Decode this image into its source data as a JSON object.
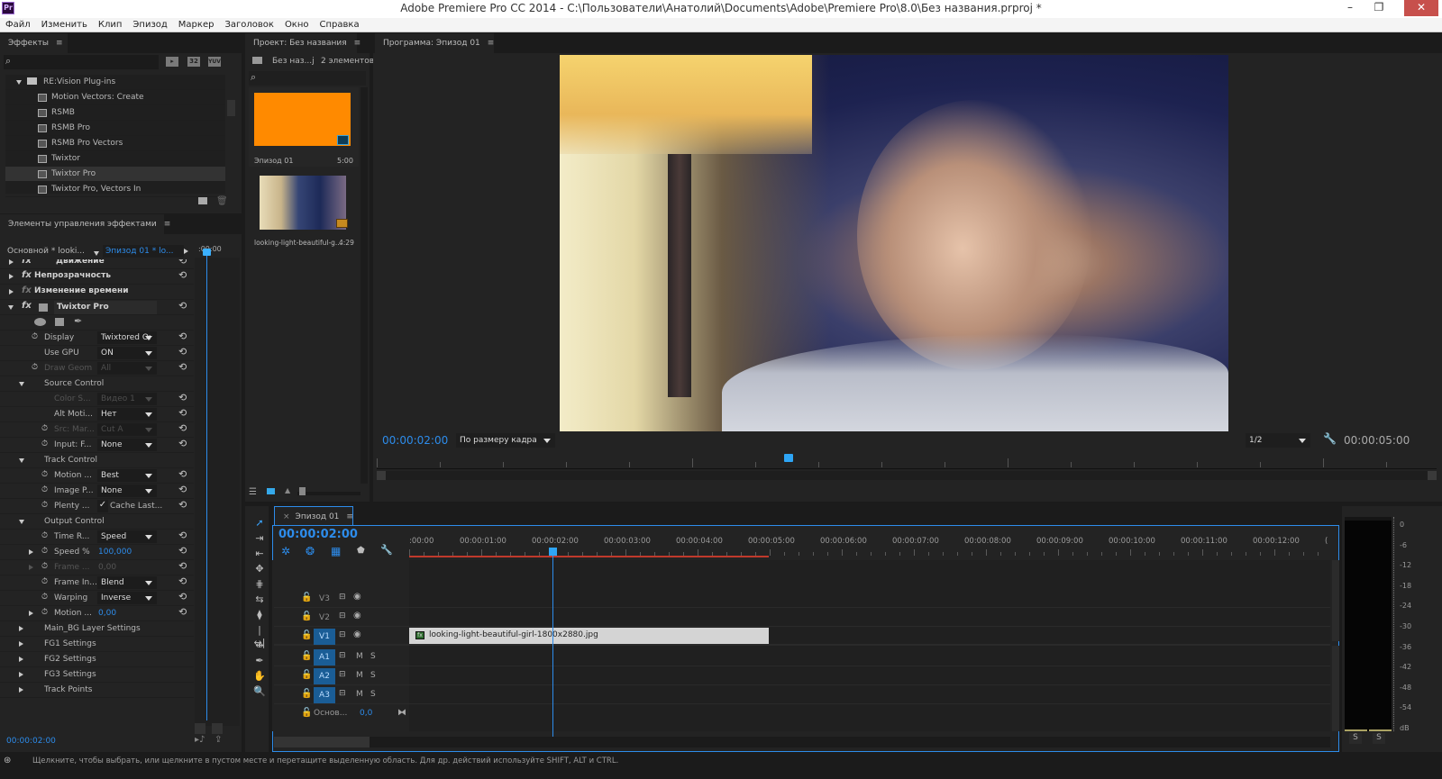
{
  "app": {
    "title": "Adobe Premiere Pro CC 2014 - C:\\Пользователи\\Анатолий\\Documents\\Adobe\\Premiere Pro\\8.0\\Без названия.prproj *",
    "logo": "Pr",
    "window_controls": {
      "minimize": "–",
      "restore": "❐",
      "close": "✕"
    }
  },
  "menu": [
    "Файл",
    "Изменить",
    "Клип",
    "Эпизод",
    "Маркер",
    "Заголовок",
    "Окно",
    "Справка"
  ],
  "effects_panel": {
    "tab": "Эффекты",
    "search_placeholder": "",
    "filter_buttons": [
      "accelerated-effects",
      "32",
      "YUV"
    ],
    "folder": "RE:Vision Plug-ins",
    "items": [
      "Motion Vectors: Create",
      "RSMB",
      "RSMB Pro",
      "RSMB Pro Vectors",
      "Twixtor",
      "Twixtor Pro",
      "Twixtor Pro, Vectors In"
    ],
    "selected_item": "Twixtor Pro"
  },
  "effect_controls": {
    "tab": "Элементы управления эффектами",
    "master_clip": "Основной * looki...",
    "sequence_clip": "Эпизод 01 * lo...",
    "mini_timecode": ":00:00",
    "effects": [
      {
        "name": "Движение"
      },
      {
        "name": "Непрозрачность"
      },
      {
        "name": "Изменение времени"
      },
      {
        "name": "Twixtor Pro"
      }
    ],
    "params": {
      "display": {
        "label": "Display",
        "value": "Twixtored Oı"
      },
      "use_gpu": {
        "label": "Use GPU",
        "value": "ON"
      },
      "draw_geom": {
        "label": "Draw Geom",
        "value": "All"
      },
      "source_control": "Source Control",
      "color_s": {
        "label": "Color S...",
        "value": "Видео 1"
      },
      "alt_moti": {
        "label": "Alt Moti...",
        "value": "Нет"
      },
      "src_mar": {
        "label": "Src: Mar...",
        "value": "Cut A"
      },
      "input_f": {
        "label": "Input: F...",
        "value": "None"
      },
      "track_control": "Track Control",
      "motion_q": {
        "label": "Motion ...",
        "value": "Best"
      },
      "image_p": {
        "label": "Image P...",
        "value": "None"
      },
      "plenty": {
        "label": "Plenty ...",
        "value": "Cache Last..."
      },
      "output_control": "Output Control",
      "time_r": {
        "label": "Time R...",
        "value": "Speed"
      },
      "speed": {
        "label": "Speed %",
        "value": "100,000"
      },
      "frame": {
        "label": "Frame ...",
        "value": "0,00"
      },
      "frame_in": {
        "label": "Frame In...",
        "value": "Blend"
      },
      "warping": {
        "label": "Warping",
        "value": "Inverse"
      },
      "motion_b": {
        "label": "Motion ...",
        "value": "0,00"
      },
      "groups": [
        "Main_BG Layer Settings",
        "FG1 Settings",
        "FG2 Settings",
        "FG3 Settings",
        "Track Points"
      ]
    },
    "timecode": "00:00:02:00"
  },
  "project_panel": {
    "tab": "Проект: Без названия",
    "name": "Без наз...j",
    "count": "2 элементов",
    "items": [
      {
        "name": "Эпизод 01",
        "duration": "5:00",
        "color": "#ff8a00"
      },
      {
        "name": "looking-light-beautiful-g...",
        "duration": "4:29"
      }
    ]
  },
  "program_monitor": {
    "tab": "Программа: Эпизод 01",
    "timecode": "00:00:02:00",
    "fit": "По размеру кадра",
    "resolution": "1/2",
    "duration": "00:00:05:00",
    "playhead_fraction": 0.4
  },
  "timeline": {
    "tab": "Эпизод 01",
    "timecode": "00:00:02:00",
    "ruler": [
      ":00:00",
      "00:00:01:00",
      "00:00:02:00",
      "00:00:03:00",
      "00:00:04:00",
      "00:00:05:00",
      "00:00:06:00",
      "00:00:07:00",
      "00:00:08:00",
      "00:00:09:00",
      "00:00:10:00",
      "00:00:11:00",
      "00:00:12:00",
      "("
    ],
    "video_tracks": [
      "V3",
      "V2",
      "V1"
    ],
    "audio_tracks": [
      "A1",
      "A2",
      "A3"
    ],
    "master": {
      "label": "Основ...",
      "value": "0,0"
    },
    "clip": "looking-light-beautiful-girl-1800x2880.jpg",
    "mute": "M",
    "solo": "S"
  },
  "audio_meter": {
    "scale": [
      "0",
      "-6",
      "-12",
      "-18",
      "-24",
      "-30",
      "-36",
      "-42",
      "-48",
      "-54",
      "dB"
    ],
    "solo_buttons": [
      "S",
      "S"
    ]
  },
  "status_bar": {
    "text": "Щелкните, чтобы выбрать, или щелкните в пустом месте и перетащите выделенную область. Для др. действий используйте SHIFT, ALT и CTRL."
  },
  "colors": {
    "accent": "#2d8ceb",
    "orange": "#ff8a00",
    "in_out_bar": "#c0392b"
  }
}
